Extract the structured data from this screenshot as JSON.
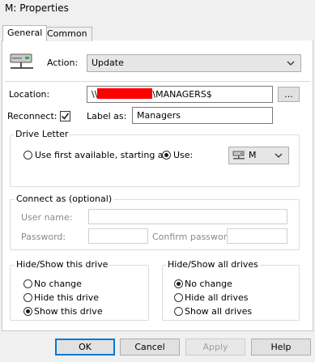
{
  "window": {
    "title": "M: Properties"
  },
  "tabs": [
    {
      "label": "General"
    },
    {
      "label": "Common"
    }
  ],
  "action": {
    "label": "Action:",
    "value": "Update"
  },
  "location": {
    "label": "Location:",
    "prefix": "\\\\",
    "suffix": "\\MANAGERS$",
    "browse_label": "..."
  },
  "reconnect": {
    "label": "Reconnect:",
    "checked": true
  },
  "label_as": {
    "label": "Label as:",
    "value": "Managers"
  },
  "drive_letter": {
    "group_label": "Drive Letter",
    "first_available_label": "Use first available, starting at:",
    "use_label": "Use:",
    "selected": "use",
    "drive_value": "M"
  },
  "connect_as": {
    "group_label": "Connect as (optional)",
    "username_label": "User name:",
    "password_label": "Password:",
    "confirm_label": "Confirm password:"
  },
  "hide_show_drive": {
    "group_label": "Hide/Show this drive",
    "options": [
      "No change",
      "Hide this drive",
      "Show this drive"
    ],
    "selected_index": 2
  },
  "hide_show_all": {
    "group_label": "Hide/Show all drives",
    "options": [
      "No change",
      "Hide all drives",
      "Show all drives"
    ],
    "selected_index": 0
  },
  "buttons": {
    "ok": "OK",
    "cancel": "Cancel",
    "apply": "Apply",
    "help": "Help"
  },
  "colors": {
    "redaction": "#ff0000",
    "focus_border": "#0078d7"
  }
}
